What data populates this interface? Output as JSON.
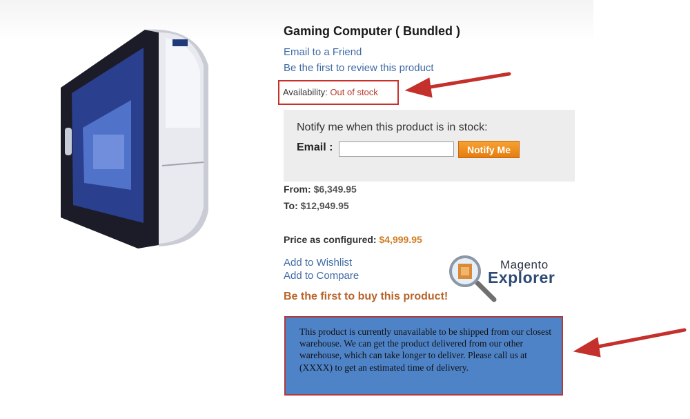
{
  "product": {
    "title": "Gaming Computer ( Bundled )",
    "email_friend_link": "Email to a Friend",
    "review_link": "Be the first to review this product",
    "availability_label": "Availability:",
    "availability_status": "Out of stock",
    "add_to_wishlist": "Add to Wishlist",
    "add_to_compare": "Add to Compare",
    "first_to_buy": "Be the first to buy this product!"
  },
  "notify": {
    "prompt": "Notify me when this product is in stock:",
    "email_label": "Email :",
    "email_value": "",
    "button_label": "Notify Me"
  },
  "pricing": {
    "from_label": "From:",
    "from_value": "$6,349.95",
    "to_label": "To:",
    "to_value": "$12,949.95",
    "configured_label": "Price as configured:",
    "configured_value": "$4,999.95"
  },
  "logo": {
    "line1": "Magento",
    "line2": "Explorer"
  },
  "annotation": {
    "message": "This product is currently unavailable to be shipped from our closest warehouse. We can get the product delivered from our other warehouse, which can take longer to deliver. Please call us at (XXXX)  to get an estimated time of delivery."
  },
  "colors": {
    "link": "#3e6aa3",
    "out_of_stock": "#b83b2e",
    "button": "#e57d10",
    "info_box": "#4e83c8",
    "highlight_border": "#c9302c"
  }
}
